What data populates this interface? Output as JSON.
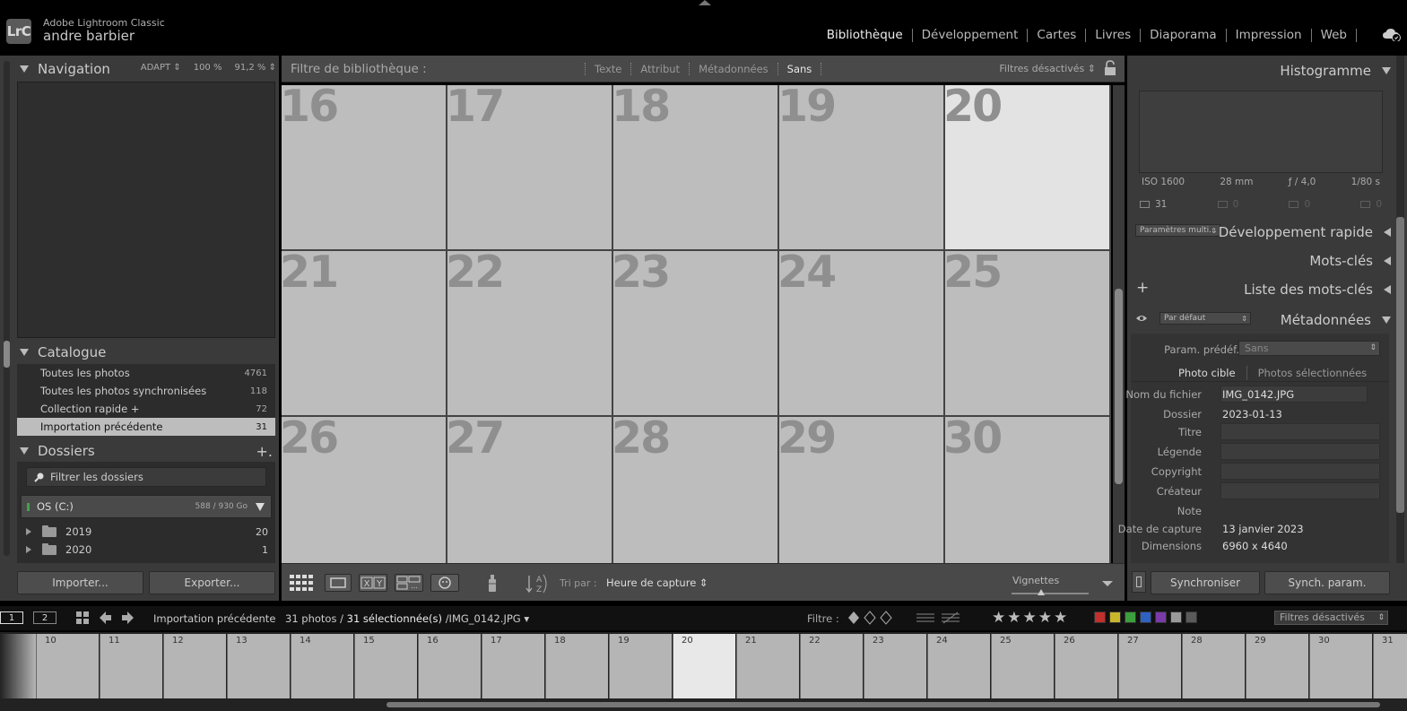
{
  "app": {
    "logo": "LrC",
    "name": "Adobe Lightroom Classic",
    "user": "andre barbier"
  },
  "modules": [
    "Bibliothèque",
    "Développement",
    "Cartes",
    "Livres",
    "Diaporama",
    "Impression",
    "Web"
  ],
  "left": {
    "navigator": {
      "title": "Navigation",
      "options": [
        "ADAPT ⇕",
        "100 %",
        "91,2 % ⇕"
      ]
    },
    "catalog": {
      "title": "Catalogue",
      "items": [
        {
          "label": "Toutes les photos",
          "count": "4761"
        },
        {
          "label": "Toutes les photos synchronisées",
          "count": "118"
        },
        {
          "label": "Collection rapide +",
          "count": "72"
        },
        {
          "label": "Importation précédente",
          "count": "31"
        }
      ]
    },
    "folders": {
      "title": "Dossiers",
      "add": "+.",
      "filter_placeholder": "Filtrer les dossiers",
      "volume": {
        "name": "OS (C:)",
        "space": "588 / 930 Go"
      },
      "items": [
        {
          "label": "2019",
          "count": "20"
        },
        {
          "label": "2020",
          "count": "1"
        }
      ]
    },
    "import_label": "Importer...",
    "export_label": "Exporter..."
  },
  "filter_bar": {
    "title": "Filtre de bibliothèque :",
    "options": [
      "Texte",
      "Attribut",
      "Métadonnées",
      "Sans"
    ],
    "status": "Filtres désactivés ⇕"
  },
  "grid": {
    "cells": [
      "16",
      "17",
      "18",
      "19",
      "20",
      "21",
      "22",
      "23",
      "24",
      "25",
      "26",
      "27",
      "28",
      "29",
      "30"
    ],
    "selected": "20"
  },
  "toolbar": {
    "sort_label": "Tri par :",
    "sort_value": "Heure de capture ⇕",
    "thumbnails_label": "Vignettes",
    "thumbnails_level": 0.38
  },
  "right": {
    "histogram": {
      "title": "Histogramme",
      "iso": "ISO 1600",
      "focal": "28 mm",
      "aperture": "ƒ / 4,0",
      "shutter": "1/80 s",
      "counts": [
        "31",
        "0",
        "0",
        "0"
      ]
    },
    "quick_develop": {
      "title": "Développement rapide",
      "preset": "Paramètres multi..."
    },
    "keywords": {
      "title": "Mots-clés"
    },
    "keyword_list": {
      "title": "Liste des mots-clés"
    },
    "metadata": {
      "title": "Métadonnées",
      "view": "Par défaut",
      "preset_label": "Param. prédéf.",
      "preset_value": "Sans",
      "tab_target": "Photo cible",
      "tab_selected": "Photos sélectionnées",
      "fields": [
        {
          "label": "Nom du fichier",
          "value": "IMG_0142.JPG"
        },
        {
          "label": "Dossier",
          "value": "2023-01-13"
        },
        {
          "label": "Titre",
          "value": ""
        },
        {
          "label": "Légende",
          "value": ""
        },
        {
          "label": "Copyright",
          "value": ""
        },
        {
          "label": "Créateur",
          "value": ""
        },
        {
          "label": "Note",
          "value": ""
        },
        {
          "label": "Date de capture",
          "value": "13 janvier 2023"
        },
        {
          "label": "Dimensions",
          "value": "6960 x 4640"
        }
      ]
    },
    "sync_label": "Synchroniser",
    "sync_settings_label": "Synch. param."
  },
  "filmstrip_bar": {
    "screen1": "1",
    "screen2": "2",
    "source": "Importation précédente",
    "count": "31 photos /",
    "selected": "31 sélectionnée(s)",
    "file": "/IMG_0142.JPG ▾",
    "filter_label": "Filtre :",
    "stars": "★★★★★",
    "filter_status": "Filtres désactivés",
    "swatches": [
      "#c0302d",
      "#c7b62b",
      "#3c9e3c",
      "#2e62c2",
      "#7a3aa8",
      "#9a9a9a",
      "#5a5a5a"
    ]
  },
  "filmstrip": {
    "cells": [
      "10",
      "11",
      "12",
      "13",
      "14",
      "15",
      "16",
      "17",
      "18",
      "19",
      "20",
      "21",
      "22",
      "23",
      "24",
      "25",
      "26",
      "27",
      "28",
      "29",
      "30",
      "31"
    ],
    "selected": "20"
  }
}
